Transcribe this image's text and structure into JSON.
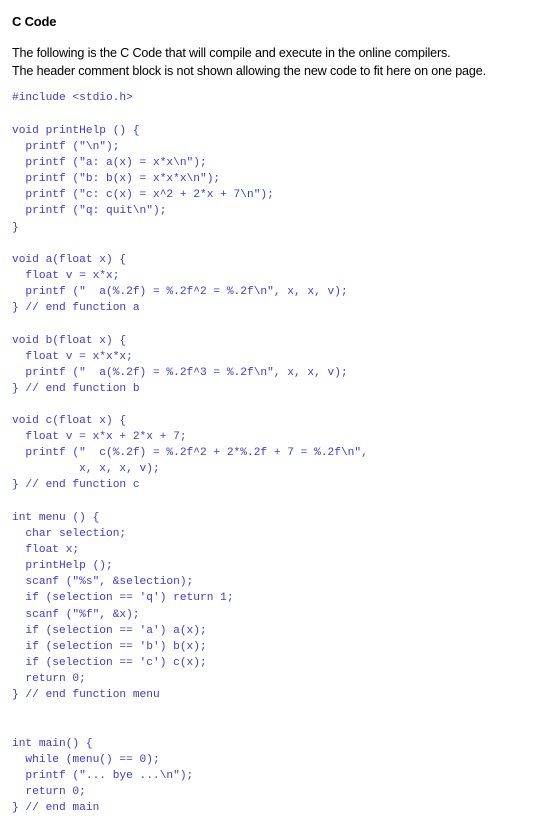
{
  "heading": "C Code",
  "intro": [
    "The following is the C Code that will compile and execute in the online compilers.",
    "The header comment block is not shown allowing the new code to fit here on one page."
  ],
  "code_color": "#3b3bd8",
  "blocks": {
    "include": [
      "#include <stdio.h>"
    ],
    "print_help": [
      "void printHelp () {",
      "  printf (\"\\n\");",
      "  printf (\"a: a(x) = x*x\\n\");",
      "  printf (\"b: b(x) = x*x*x\\n\");",
      "  printf (\"c: c(x) = x^2 + 2*x + 7\\n\");",
      "  printf (\"q: quit\\n\");",
      "}"
    ],
    "func_a": [
      "void a(float x) {",
      "  float v = x*x;",
      "  printf (\"  a(%.2f) = %.2f^2 = %.2f\\n\", x, x, v);",
      "} // end function a"
    ],
    "func_b": [
      "void b(float x) {",
      "  float v = x*x*x;",
      "  printf (\"  a(%.2f) = %.2f^3 = %.2f\\n\", x, x, v);",
      "} // end function b"
    ],
    "func_c": [
      "void c(float x) {",
      "  float v = x*x + 2*x + 7;",
      "  printf (\"  c(%.2f) = %.2f^2 + 2*%.2f + 7 = %.2f\\n\",",
      "          x, x, x, v);",
      "} // end function c"
    ],
    "menu": [
      "int menu () {",
      "  char selection;",
      "  float x;",
      "  printHelp ();",
      "  scanf (\"%s\", &selection);",
      "  if (selection == 'q') return 1;",
      "  scanf (\"%f\", &x);",
      "  if (selection == 'a') a(x);",
      "  if (selection == 'b') b(x);",
      "  if (selection == 'c') c(x);",
      "  return 0;",
      "} // end function menu"
    ],
    "main": [
      "int main() {",
      "  while (menu() == 0);",
      "  printf (\"... bye ...\\n\");",
      "  return 0;",
      "} // end main"
    ]
  }
}
